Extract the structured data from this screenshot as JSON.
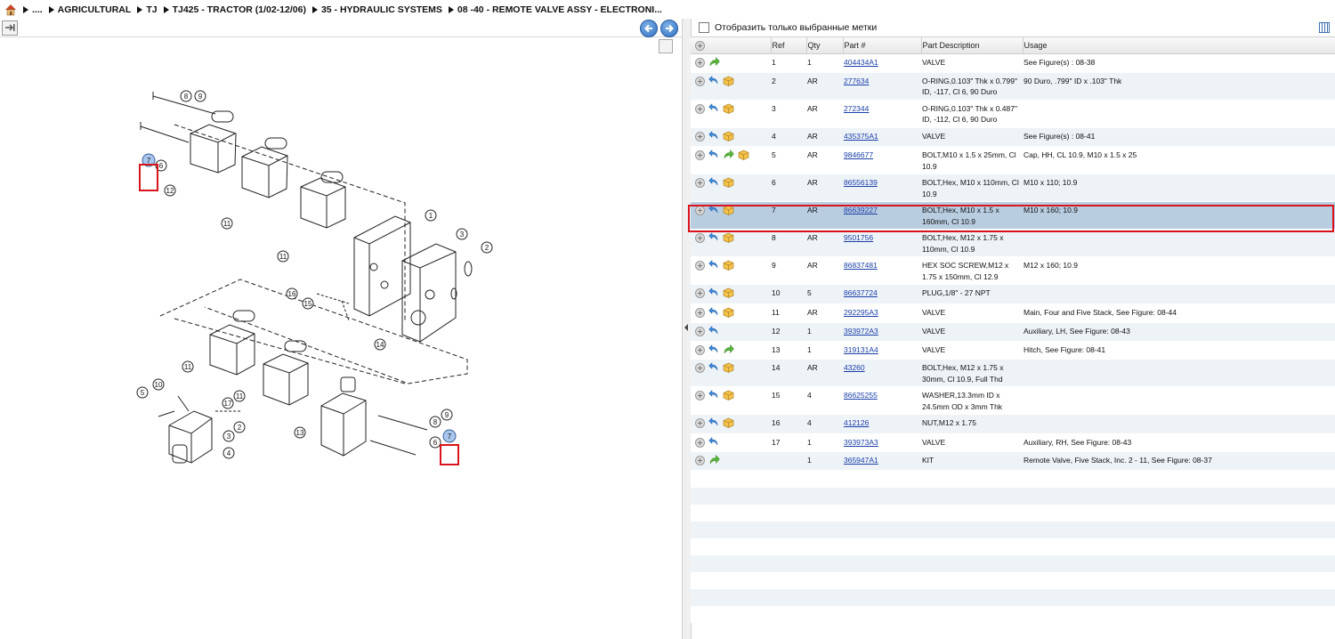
{
  "breadcrumb": [
    {
      "label": "...."
    },
    {
      "label": "AGRICULTURAL"
    },
    {
      "label": "TJ"
    },
    {
      "label": "TJ425 - TRACTOR (1/02-12/06)"
    },
    {
      "label": "35 - HYDRAULIC SYSTEMS"
    },
    {
      "label": "08 -40 - REMOTE VALVE ASSY - ELECTRONI..."
    }
  ],
  "filter": {
    "label": "Отобразить только выбранные метки"
  },
  "columns": {
    "ref": "Ref",
    "qty": "Qty",
    "part": "Part #",
    "desc": "Part Description",
    "usage": "Usage"
  },
  "accent_color": "#d9141d",
  "rows": [
    {
      "ref": "1",
      "qty": "1",
      "part": "404434A1",
      "desc": "VALVE",
      "usage": "See Figure(s) : 08-38",
      "icons": [
        "arrow-green"
      ]
    },
    {
      "ref": "2",
      "qty": "AR",
      "part": "277634",
      "desc": "O-RING,0.103\" Thk x 0.799\" ID, -117, Cl 6, 90 Duro",
      "usage": "90 Duro, .799\" ID x .103\" Thk",
      "icons": [
        "arrow-blue",
        "box"
      ]
    },
    {
      "ref": "3",
      "qty": "AR",
      "part": "272344",
      "desc": "O-RING,0.103\" Thk x 0.487\" ID, -112, Cl 6, 90 Duro",
      "usage": "",
      "icons": [
        "arrow-blue",
        "box"
      ]
    },
    {
      "ref": "4",
      "qty": "AR",
      "part": "435375A1",
      "desc": "VALVE",
      "usage": "See Figure(s) : 08-41",
      "icons": [
        "arrow-blue",
        "box"
      ]
    },
    {
      "ref": "5",
      "qty": "AR",
      "part": "9846677",
      "desc": "BOLT,M10 x 1.5 x 25mm, Cl 10.9",
      "usage": "Cap, HH, CL 10.9, M10 x 1.5 x 25",
      "icons": [
        "arrow-blue",
        "arrow-green",
        "box"
      ]
    },
    {
      "ref": "6",
      "qty": "AR",
      "part": "86556139",
      "desc": "BOLT,Hex, M10 x 110mm, Cl 10.9",
      "usage": "M10 x 110; 10.9",
      "icons": [
        "arrow-blue",
        "box"
      ]
    },
    {
      "ref": "7",
      "qty": "AR",
      "part": "86639227",
      "desc": "BOLT,Hex, M10 x 1.5 x 160mm, Cl 10.9",
      "usage": "M10 x 160; 10.9",
      "icons": [
        "arrow-blue",
        "box"
      ],
      "selected": true
    },
    {
      "ref": "8",
      "qty": "AR",
      "part": "9501756",
      "desc": "BOLT,Hex, M12 x 1.75 x 110mm, Cl 10.9",
      "usage": "",
      "icons": [
        "arrow-blue",
        "box"
      ]
    },
    {
      "ref": "9",
      "qty": "AR",
      "part": "86837481",
      "desc": "HEX SOC SCREW,M12 x 1.75 x 150mm, Cl 12.9",
      "usage": "M12 x 160; 10.9",
      "icons": [
        "arrow-blue",
        "box"
      ]
    },
    {
      "ref": "10",
      "qty": "5",
      "part": "86637724",
      "desc": "PLUG,1/8\" - 27 NPT",
      "usage": "",
      "icons": [
        "arrow-blue",
        "box"
      ]
    },
    {
      "ref": "11",
      "qty": "AR",
      "part": "292295A3",
      "desc": "VALVE",
      "usage": "Main, Four and Five Stack, See Figure: 08-44",
      "icons": [
        "arrow-blue",
        "box"
      ]
    },
    {
      "ref": "12",
      "qty": "1",
      "part": "393972A3",
      "desc": "VALVE",
      "usage": "Auxiliary, LH, See Figure: 08-43",
      "icons": [
        "arrow-blue"
      ]
    },
    {
      "ref": "13",
      "qty": "1",
      "part": "319131A4",
      "desc": "VALVE",
      "usage": "Hitch, See Figure: 08-41",
      "icons": [
        "arrow-blue",
        "arrow-green"
      ]
    },
    {
      "ref": "14",
      "qty": "AR",
      "part": "43260",
      "desc": "BOLT,Hex, M12 x 1.75 x 30mm, Cl 10.9, Full Thd",
      "usage": "",
      "icons": [
        "arrow-blue",
        "box"
      ]
    },
    {
      "ref": "15",
      "qty": "4",
      "part": "86625255",
      "desc": "WASHER,13.3mm ID x 24.5mm OD x 3mm Thk",
      "usage": "",
      "icons": [
        "arrow-blue",
        "box"
      ]
    },
    {
      "ref": "16",
      "qty": "4",
      "part": "412126",
      "desc": "NUT,M12 x 1.75",
      "usage": "",
      "icons": [
        "arrow-blue",
        "box"
      ]
    },
    {
      "ref": "17",
      "qty": "1",
      "part": "393973A3",
      "desc": "VALVE",
      "usage": "Auxiliary, RH, See Figure: 08-43",
      "icons": [
        "arrow-blue"
      ]
    },
    {
      "ref": "",
      "qty": "1",
      "part": "365947A1",
      "desc": "KIT",
      "usage": "Remote Valve, Five Stack, Inc. 2 - 11, See Figure: 08-37",
      "icons": [
        "arrow-green"
      ]
    }
  ],
  "callouts": [
    {
      "label": "8"
    },
    {
      "label": "9"
    },
    {
      "label": "7"
    },
    {
      "label": "6"
    },
    {
      "label": "12"
    },
    {
      "label": "11"
    },
    {
      "label": "11"
    },
    {
      "label": "1"
    },
    {
      "label": "3"
    },
    {
      "label": "2"
    },
    {
      "label": "16"
    },
    {
      "label": "15"
    },
    {
      "label": "14"
    },
    {
      "label": "11"
    },
    {
      "label": "10"
    },
    {
      "label": "5"
    },
    {
      "label": "17"
    },
    {
      "label": "11"
    },
    {
      "label": "2"
    },
    {
      "label": "3"
    },
    {
      "label": "4"
    },
    {
      "label": "13"
    },
    {
      "label": "8"
    },
    {
      "label": "9"
    },
    {
      "label": "6"
    },
    {
      "label": "7"
    }
  ]
}
